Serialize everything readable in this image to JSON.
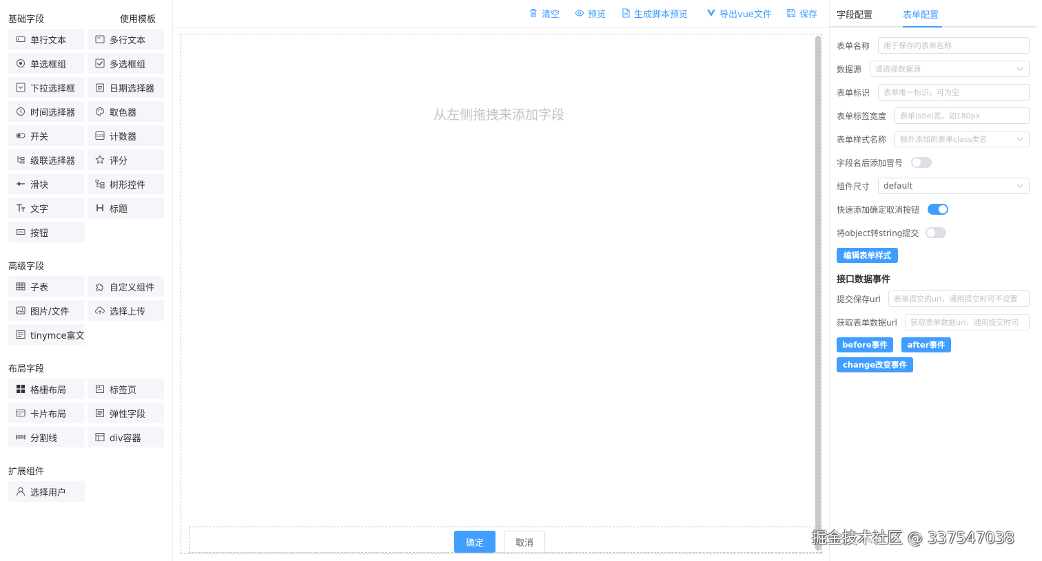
{
  "left": {
    "basic_title": "基础字段",
    "template_link": "使用模板",
    "basic": [
      {
        "label": "单行文本",
        "icon": "input-icon"
      },
      {
        "label": "多行文本",
        "icon": "textarea-icon"
      },
      {
        "label": "单选框组",
        "icon": "radio-icon"
      },
      {
        "label": "多选框组",
        "icon": "checkbox-icon"
      },
      {
        "label": "下拉选择框",
        "icon": "select-icon"
      },
      {
        "label": "日期选择器",
        "icon": "date-icon"
      },
      {
        "label": "时间选择器",
        "icon": "clock-icon"
      },
      {
        "label": "取色器",
        "icon": "palette-icon"
      },
      {
        "label": "开关",
        "icon": "switch-icon"
      },
      {
        "label": "计数器",
        "icon": "counter-icon"
      },
      {
        "label": "级联选择器",
        "icon": "cascader-icon"
      },
      {
        "label": "评分",
        "icon": "star-icon"
      },
      {
        "label": "滑块",
        "icon": "slider-icon"
      },
      {
        "label": "树形控件",
        "icon": "tree-icon"
      },
      {
        "label": "文字",
        "icon": "text-icon"
      },
      {
        "label": "标题",
        "icon": "heading-icon"
      },
      {
        "label": "按钮",
        "icon": "button-icon"
      }
    ],
    "advanced_title": "高级字段",
    "advanced": [
      {
        "label": "子表",
        "icon": "table-icon"
      },
      {
        "label": "自定义组件",
        "icon": "puzzle-icon"
      },
      {
        "label": "图片/文件",
        "icon": "image-icon"
      },
      {
        "label": "选择上传",
        "icon": "upload-icon"
      },
      {
        "label": "tinymce富文本",
        "icon": "rich-text-icon"
      }
    ],
    "layout_title": "布局字段",
    "layout": [
      {
        "label": "格栅布局",
        "icon": "grid-icon"
      },
      {
        "label": "标签页",
        "icon": "tabs-icon"
      },
      {
        "label": "卡片布局",
        "icon": "card-icon"
      },
      {
        "label": "弹性字段",
        "icon": "flex-icon"
      },
      {
        "label": "分割线",
        "icon": "divider-icon"
      },
      {
        "label": "div容器",
        "icon": "div-icon"
      }
    ],
    "ext_title": "扩展组件",
    "ext": [
      {
        "label": "选择用户",
        "icon": "user-icon"
      }
    ]
  },
  "toolbar": {
    "clear": "清空",
    "preview": "预览",
    "script_preview": "生成脚本预览",
    "export_vue": "导出vue文件",
    "save": "保存"
  },
  "canvas": {
    "placeholder": "从左侧拖拽来添加字段",
    "ok": "确定",
    "cancel": "取消"
  },
  "right": {
    "tab_field": "字段配置",
    "tab_form": "表单配置",
    "form_name_label": "表单名称",
    "form_name_ph": "用于保存的表单名称",
    "datasource_label": "数据源",
    "datasource_ph": "请选择数据源",
    "form_id_label": "表单标识",
    "form_id_ph": "表单唯一标识，可为空",
    "label_width_label": "表单标签宽度",
    "label_width_ph": "表单label宽，如180px",
    "style_class_label": "表单样式名称",
    "style_class_ph": "额外添加的表单class类名",
    "colon_label": "字段名后添加冒号",
    "colon_on": false,
    "size_label": "组件尺寸",
    "size_value": "default",
    "quick_btn_label": "快速添加确定取消按钮",
    "quick_btn_on": true,
    "obj2str_label": "将object转string提交",
    "obj2str_on": false,
    "edit_style_btn": "编辑表单样式",
    "api_section": "接口数据事件",
    "submit_url_label": "提交保存url",
    "submit_url_ph": "表单提交的url，通用提交时可不设置",
    "fetch_url_label": "获取表单数据url",
    "fetch_url_ph": "获取表单数据url，通用提交时可",
    "before_btn": "before事件",
    "after_btn": "after事件",
    "change_btn": "change改变事件"
  },
  "watermark": "掘金技术社区 @ 337547038",
  "colors": {
    "primary": "#409eff",
    "border": "#dcdfe6",
    "comp_bg": "#f4f6fa"
  }
}
